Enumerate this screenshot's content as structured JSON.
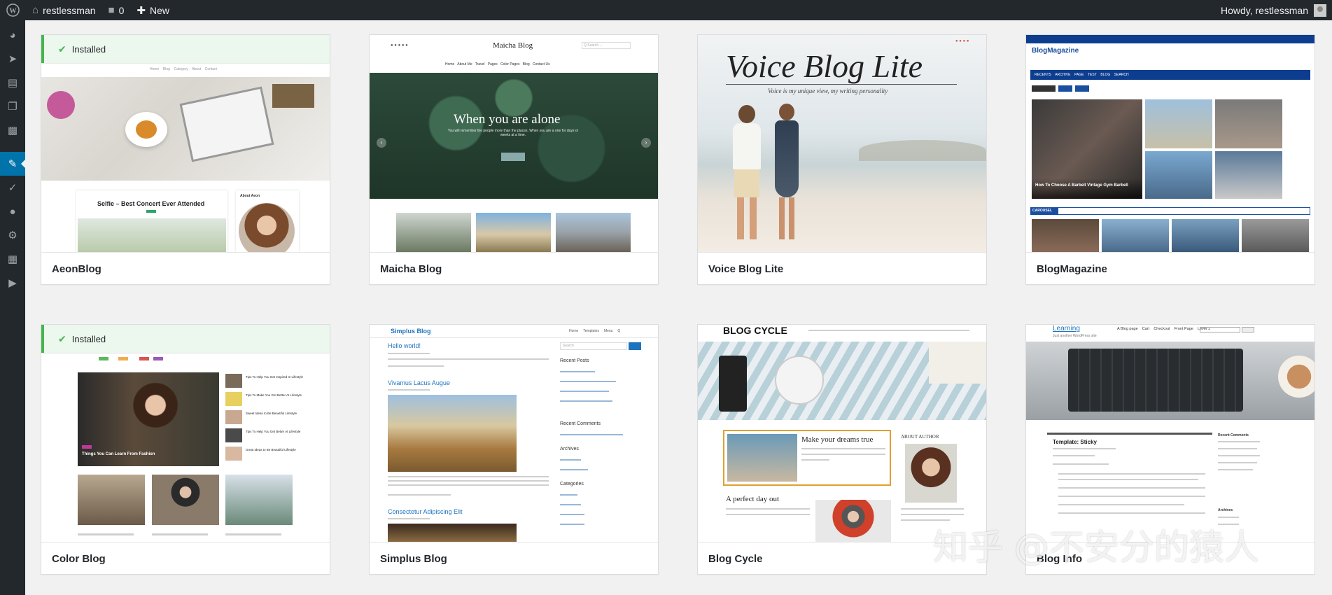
{
  "adminbar": {
    "site_name": "restlessman",
    "comments_count": "0",
    "new_label": "New",
    "greeting": "Howdy, restlessman"
  },
  "installed_label": "Installed",
  "themes": [
    {
      "name": "AeonBlog",
      "installed": true,
      "preview": {
        "nav": [
          "Home",
          "Blog",
          "Category",
          "About",
          "Contact"
        ],
        "post_title": "Selfie – Best Concert Ever Attended",
        "widget_title": "About Aeon"
      }
    },
    {
      "name": "Maicha Blog",
      "installed": false,
      "preview": {
        "site_title": "Maicha Blog",
        "nav": [
          "Home",
          "About Me",
          "Travel",
          "Pages",
          "Color Pages",
          "Blog",
          "Contact Us"
        ],
        "hero_title": "When you are alone",
        "hero_text": "You will remember the people more than the places. When you are a one for days or weeks at a time.",
        "search_placeholder": "Q Search ..."
      }
    },
    {
      "name": "Voice Blog Lite",
      "installed": false,
      "preview": {
        "headline": "Voice Blog Lite",
        "tagline": "Voice is my unique view, my writing personality"
      }
    },
    {
      "name": "BlogMagazine",
      "installed": false,
      "preview": {
        "site_title": "BlogMagazine",
        "nav": [
          "RECENTS",
          "ARCHIVE",
          "PAGE",
          "TEST",
          "BLOG",
          "SEARCH"
        ],
        "featured_title": "How To Choose A Barbell Vintage Gym Barbell",
        "section_label": "CAROUSEL"
      }
    },
    {
      "name": "Color Blog",
      "installed": true,
      "preview": {
        "featured_title": "Things You Can Learn From Fashion",
        "side_posts": [
          "Tips To Help You Get Inspired In Lifestyle",
          "Tips To Make You Get Better At Lifestyle",
          "Sweet Ideas to Be Beautiful Lifestyle",
          "Tips To Help You Get Better At Lifestyle",
          "Great Ideas to Be Beautiful Lifestyle"
        ]
      }
    },
    {
      "name": "Simplus Blog",
      "installed": false,
      "preview": {
        "site_title": "Simplus Blog",
        "nav": [
          "Home",
          "Templates",
          "Menu",
          "Q"
        ],
        "post1_title": "Hello world!",
        "post2_title": "Vivamus Lacus Augue",
        "post3_title": "Consectetur Adipiscing Elit",
        "widgets": [
          "Recent Posts",
          "Recent Comments",
          "Archives",
          "Categories"
        ],
        "search_placeholder": "Search"
      }
    },
    {
      "name": "Blog Cycle",
      "installed": false,
      "preview": {
        "site_title": "BLOG CYCLE",
        "post1_title": "Make your dreams true",
        "post2_title": "A perfect day out",
        "widget_title": "ABOUT AUTHOR"
      }
    },
    {
      "name": "Blog Info",
      "installed": false,
      "preview": {
        "site_title": "Learning",
        "tagline": "Just another WordPress site",
        "nav": [
          "A Blog page",
          "Cart",
          "Checkout",
          "Front Page",
          "Level 1"
        ],
        "post_title": "Template: Sticky",
        "widgets": [
          "Recent Comments",
          "Archives"
        ]
      }
    }
  ],
  "watermark": "知乎 @不安分的猿人",
  "colors": {
    "adminbar_bg": "#23282d",
    "active_menu": "#0073aa",
    "installed_green": "#46b450"
  },
  "icons": [
    "wordpress-logo-icon",
    "home-icon",
    "comment-icon",
    "plus-icon",
    "dashboard-icon",
    "pin-icon",
    "media-icon",
    "pages-icon",
    "comments-icon",
    "appearance-icon",
    "plugins-icon",
    "users-icon",
    "tools-icon",
    "settings-icon",
    "collapse-icon",
    "check-icon"
  ]
}
